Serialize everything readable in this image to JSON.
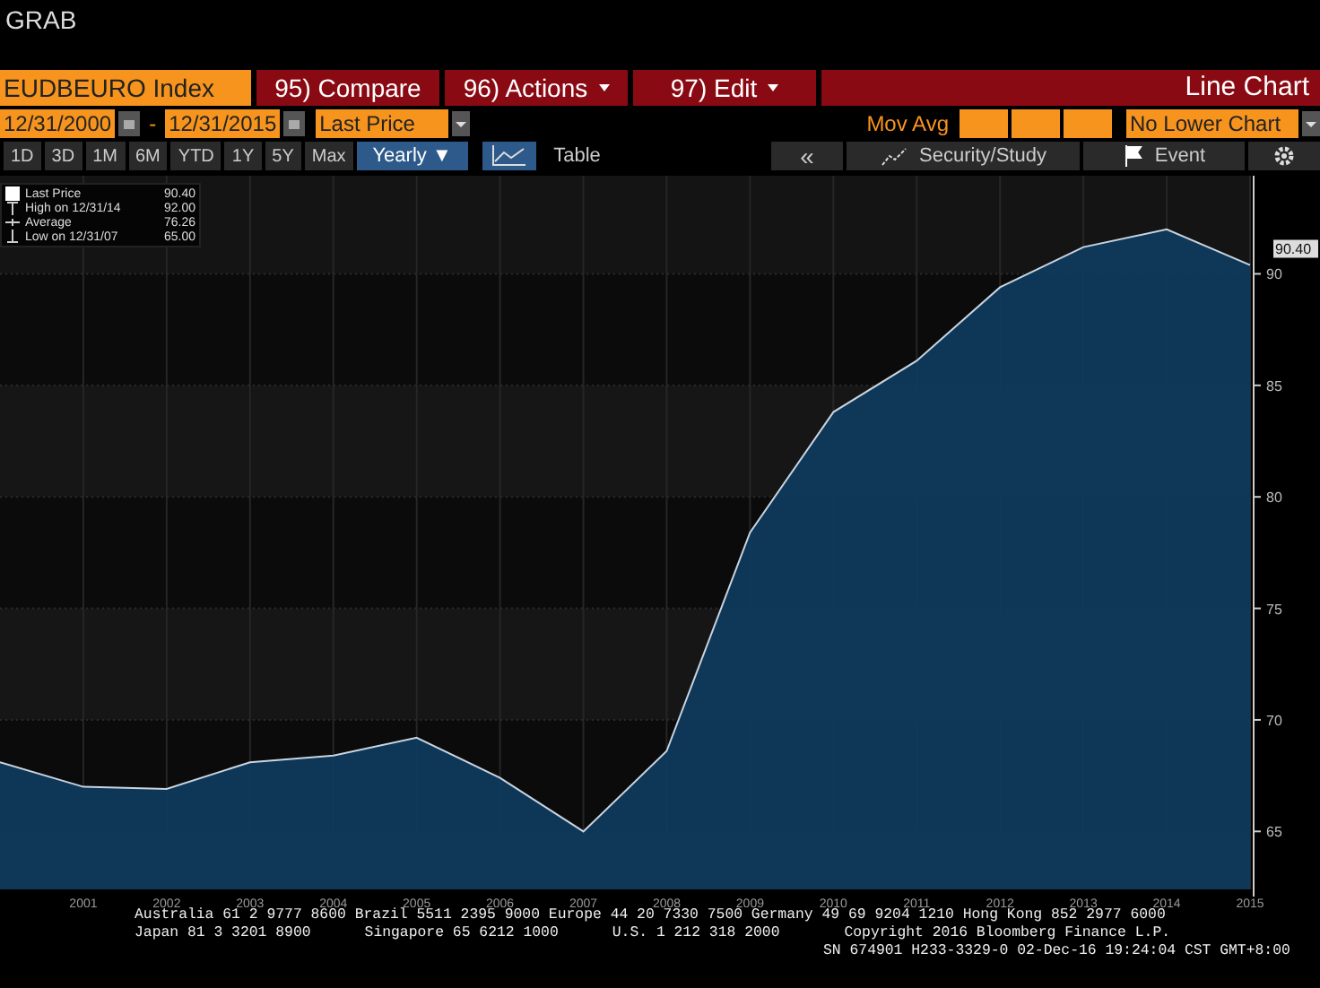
{
  "window": {
    "title": "GRAB"
  },
  "header": {
    "ticker": "EUDBEURO Index",
    "menus": [
      {
        "num": "95)",
        "label": "Compare",
        "dropdown": false
      },
      {
        "num": "96)",
        "label": "Actions",
        "dropdown": true
      },
      {
        "num": "97)",
        "label": "Edit",
        "dropdown": true
      }
    ],
    "chart_type": "Line Chart"
  },
  "range": {
    "start": "12/31/2000",
    "separator": "-",
    "end": "12/31/2015",
    "field": "Last Price",
    "mov_avg_label": "Mov Avg",
    "lower_chart": "No Lower Chart"
  },
  "periods": [
    {
      "label": "1D",
      "selected": false
    },
    {
      "label": "3D",
      "selected": false
    },
    {
      "label": "1M",
      "selected": false
    },
    {
      "label": "6M",
      "selected": false
    },
    {
      "label": "YTD",
      "selected": false
    },
    {
      "label": "1Y",
      "selected": false
    },
    {
      "label": "5Y",
      "selected": false
    },
    {
      "label": "Max",
      "selected": false
    }
  ],
  "frequency": {
    "label": "Yearly ▼"
  },
  "view_tabs": [
    {
      "kind": "chart",
      "selected": true
    },
    {
      "kind": "text",
      "label": "Table",
      "selected": false
    }
  ],
  "tools": {
    "back": "«",
    "security": "Security/Study",
    "event": "Event"
  },
  "legend": [
    {
      "kind": "swatch",
      "value": "90.40"
    },
    {
      "kind": "high",
      "label": "High on 12/31/14",
      "value": "92.00"
    },
    {
      "kind": "avg",
      "label": "Average",
      "value": "76.26"
    },
    {
      "kind": "low",
      "label": "Low on 12/31/07",
      "value": "65.00"
    }
  ],
  "last_value_badge": "90.40",
  "chart_data": {
    "type": "area",
    "x": [
      2000,
      2001,
      2002,
      2003,
      2004,
      2005,
      2006,
      2007,
      2008,
      2009,
      2010,
      2011,
      2012,
      2013,
      2014,
      2015
    ],
    "series": [
      {
        "name": "Last Price",
        "color": "#0f3a5c",
        "values": [
          68.1,
          67.0,
          66.9,
          68.1,
          68.4,
          69.2,
          67.4,
          65.0,
          68.6,
          78.4,
          83.8,
          86.1,
          89.4,
          91.2,
          92.0,
          90.4
        ]
      }
    ],
    "xlim": [
      2000,
      2015
    ],
    "ylim": [
      62.4,
      94.4
    ],
    "xticks": [
      2001,
      2002,
      2003,
      2004,
      2005,
      2006,
      2007,
      2008,
      2009,
      2010,
      2011,
      2012,
      2013,
      2014,
      2015
    ],
    "yticks": [
      65,
      70,
      75,
      80,
      85,
      90
    ],
    "grid": true
  },
  "footer": {
    "line1": "Australia 61 2 9777 8600 Brazil 5511 2395 9000 Europe 44 20 7330 7500 Germany 49 69 9204 1210 Hong Kong 852 2977 6000",
    "line2": [
      "Japan 81 3 3201 8900",
      "Singapore 65 6212 1000",
      "U.S. 1 212 318 2000",
      "Copyright 2016 Bloomberg Finance L.P."
    ],
    "line3": "SN 674901 H233-3329-0 02-Dec-16 19:24:04 CST  GMT+8:00"
  }
}
